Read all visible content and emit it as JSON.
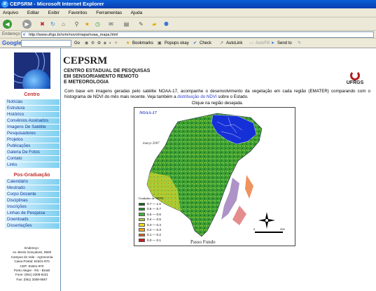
{
  "window": {
    "title": "CEPSRM - Microsoft Internet Explorer"
  },
  "menu": [
    "Arquivo",
    "Editar",
    "Exibir",
    "Favoritos",
    "Ferramentas",
    "Ajuda"
  ],
  "address": {
    "label": "Endereço",
    "url": "http://www.ufrgs.br/srm/novo/mapa/noaa_mapa.html"
  },
  "google_toolbar": {
    "logo": "Google",
    "go_label": "Go",
    "bookmarks": "Bookmarks",
    "popups": "Popups okay",
    "check": "Check",
    "autolink": "AutoLink",
    "autofill": "AutoFill",
    "sendto": "Send to"
  },
  "header": {
    "title": "CEPSRM",
    "subtitle_lines": [
      "CENTRO ESTADUAL DE PESQUISAS",
      "EM SENSORIAMENTO REMOTO",
      "E METEOROLOGIA"
    ],
    "badge": "UFRGS"
  },
  "sidebar": {
    "centro_heading": "Centro",
    "centro_items": [
      "Notícias",
      "Estrutura",
      "Histórico",
      "Convênios Assinados",
      "Imagens De Satélite",
      "Pesquisadores",
      "Projetos",
      "Publicações",
      "Galeria De Fotos",
      "Contato",
      "Links"
    ],
    "pos_heading": "Pos-Graduação",
    "pos_items": [
      "Calendário",
      "Mestrado",
      "Corpo Docente",
      "Disciplinas",
      "Inscrições",
      "Linhas de Pesquisa",
      "Downloads",
      "Dissertações"
    ],
    "address_lines": [
      "Endereço:",
      "Av. Bento Gonçalves, 9500",
      "Campus do Vale - Agronomia",
      "Caixa Postal: 91501-970",
      "CEP: 91501-970",
      "Porto Alegre - RS - Brasil",
      "Fone: (051) 3308-6221",
      "Fax: (051) 3308-6657"
    ]
  },
  "main": {
    "text_before_link": "Com base em imagens geradas pelo satélite NOAA-17, acompanhe o desenvolvimento da vegetação em cada região (EMATER) comparando com o histograma de NDVI do mês mais recente. Veja também a ",
    "link_text": "distribuição do NDVI",
    "text_after_link": " sobre o Estado.",
    "click_hint": "Clique na região desejada."
  },
  "map": {
    "title": "NOAA-17",
    "date": "março 2007",
    "legend_title": "Unidades de NDVI",
    "legend": [
      {
        "label": "0.7 — 1.0",
        "color": "#0a6b1e"
      },
      {
        "label": "0.6 — 0.7",
        "color": "#1f8f2a"
      },
      {
        "label": "0.5 — 0.6",
        "color": "#45b43a"
      },
      {
        "label": "0.4 — 0.5",
        "color": "#a8d838"
      },
      {
        "label": "0.3 — 0.4",
        "color": "#f0e41a"
      },
      {
        "label": "0.2 — 0.3",
        "color": "#f5a81a"
      },
      {
        "label": "0.1 — 0.2",
        "color": "#e8641a"
      },
      {
        "label": "0.0 — 0.1",
        "color": "#cc1a1a"
      }
    ],
    "caption": "Passo Fundo",
    "scale_start": "0",
    "scale_end": "200"
  }
}
